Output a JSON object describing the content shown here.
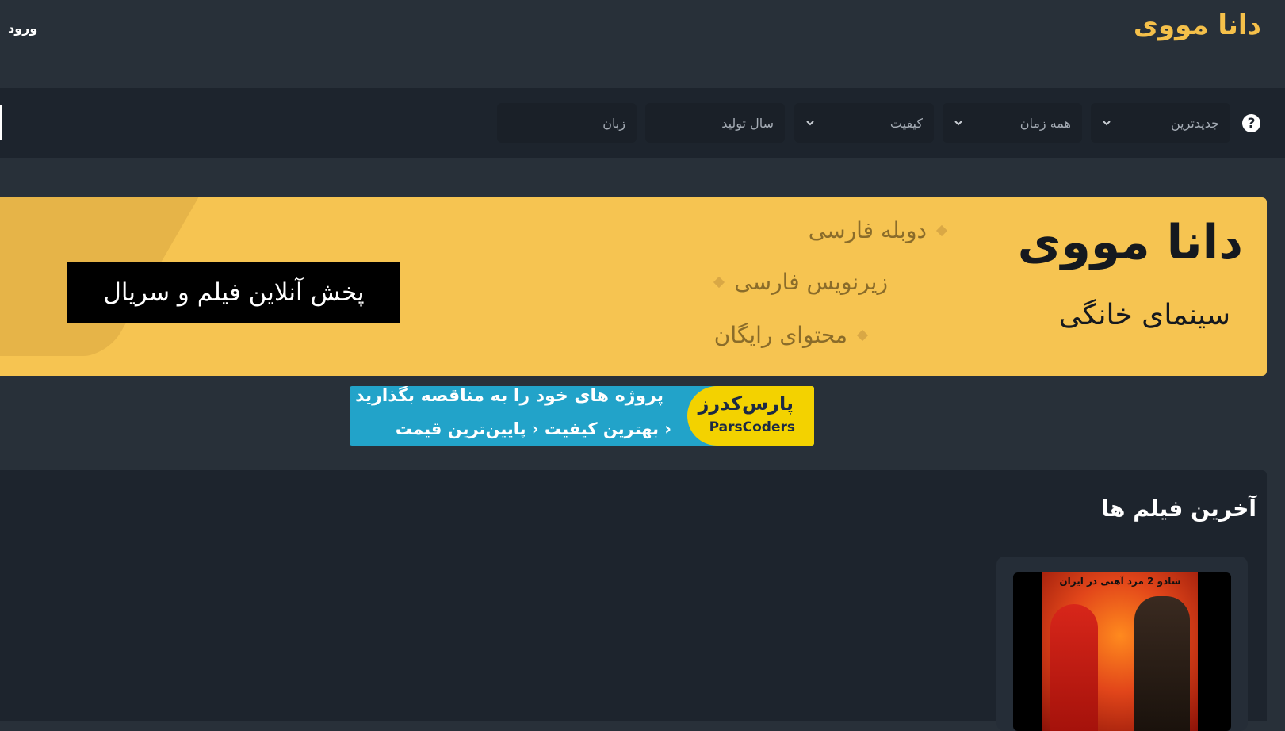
{
  "header": {
    "logo": "دانا مووی",
    "login": "ورود"
  },
  "filters": {
    "sort": "جدیدترین",
    "time": "همه زمان",
    "quality": "کیفیت",
    "year_placeholder": "سال تولید",
    "language_placeholder": "زبان"
  },
  "hero": {
    "title": "دانا مووی",
    "subtitle": "سینمای خانگی",
    "features": [
      "دوبله فارسی",
      "زیرنویس فارسی",
      "محتوای رایگان"
    ],
    "cta": "پخش آنلاین فیلم و سریال"
  },
  "ad": {
    "brand_fa": "پارس‌کدرز",
    "brand_en": "ParsCoders",
    "line1": "پروژه های خود را به مناقصه بگذارید",
    "line2": "‹ بهترین کیفیت ‹ پایین‌ترین قیمت"
  },
  "latest": {
    "title": "آخرین فیلم ها",
    "cards": [
      {
        "poster_caption": "شادو 2 مرد آهنی در ایران"
      }
    ]
  },
  "colors": {
    "accent": "#f5c04a",
    "background": "#283039",
    "panel": "#1d242d"
  }
}
